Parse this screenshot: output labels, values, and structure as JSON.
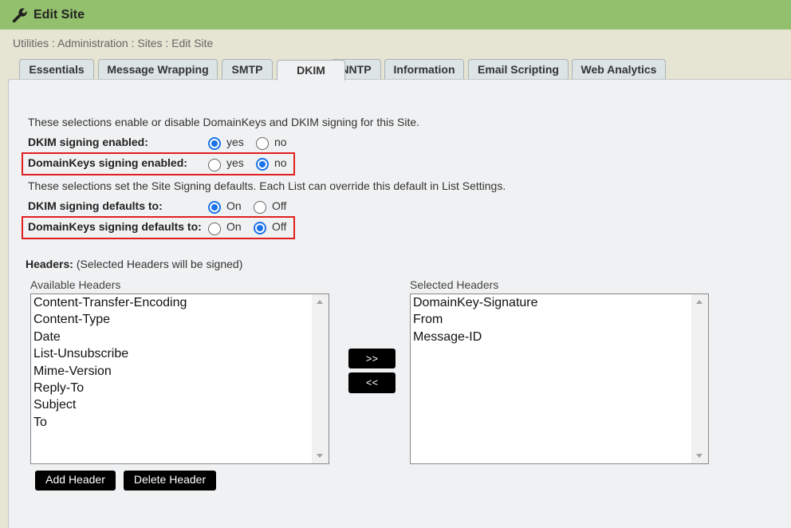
{
  "header": {
    "title": "Edit Site",
    "icon": "wrench-icon"
  },
  "breadcrumb": "Utilities : Administration : Sites : Edit Site",
  "tabs": [
    {
      "label": "Essentials",
      "active": false
    },
    {
      "label": "Message Wrapping",
      "active": false
    },
    {
      "label": "SMTP",
      "active": false
    },
    {
      "label": "DKIM",
      "active": true
    },
    {
      "label": "NNTP",
      "active": false
    },
    {
      "label": "Information",
      "active": false
    },
    {
      "label": "Email Scripting",
      "active": false
    },
    {
      "label": "Web Analytics",
      "active": false
    }
  ],
  "signing": {
    "intro": "These selections enable or disable DomainKeys and DKIM signing for this Site.",
    "dkim_enabled": {
      "label": "DKIM signing enabled:",
      "yes": "yes",
      "no": "no",
      "value": "yes"
    },
    "domainkeys_enabled": {
      "label": "DomainKeys signing enabled:",
      "yes": "yes",
      "no": "no",
      "value": "no"
    }
  },
  "defaults": {
    "intro": "These selections set the Site Signing defaults. Each List can override this default in List Settings.",
    "dkim_default": {
      "label": "DKIM signing defaults to:",
      "on": "On",
      "off": "Off",
      "value": "On"
    },
    "domainkeys_default": {
      "label": "DomainKeys signing defaults to:",
      "on": "On",
      "off": "Off",
      "value": "Off"
    }
  },
  "headers": {
    "title": "Headers:",
    "subtitle": "(Selected Headers will be signed)",
    "available_caption": "Available Headers",
    "selected_caption": "Selected Headers",
    "available": [
      "Content-Transfer-Encoding",
      "Content-Type",
      "Date",
      "List-Unsubscribe",
      "Mime-Version",
      "Reply-To",
      "Subject",
      "To"
    ],
    "selected": [
      "DomainKey-Signature",
      "From",
      "Message-ID"
    ],
    "move_right_label": ">>",
    "move_left_label": "<<",
    "add_label": "Add Header",
    "delete_label": "Delete Header"
  },
  "colors": {
    "header_bar": "#93c06c",
    "highlight": "#e02020",
    "radio_checked": "#1a73e8"
  }
}
